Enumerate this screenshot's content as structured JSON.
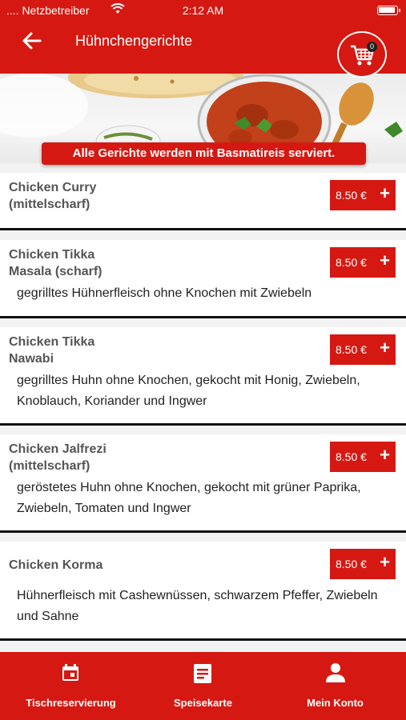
{
  "status_bar": {
    "carrier": "....  Netzbetreiber",
    "time": "2:12 AM"
  },
  "header": {
    "title": "Hühnchengerichte",
    "cart_count": "0"
  },
  "notice": "Alle Gerichte werden mit Basmatireis serviert.",
  "items": [
    {
      "name_line1": "Chicken Curry",
      "name_line2": "(mittelscharf)",
      "price": "8.50 €",
      "desc_line1": "",
      "desc_line2": ""
    },
    {
      "name_line1": "Chicken Tikka",
      "name_line2": "Masala (scharf)",
      "price": "8.50 €",
      "desc_line1": "gegrilltes Hühnerfleisch ohne Knochen mit Zwiebeln",
      "desc_line2": ""
    },
    {
      "name_line1": "Chicken Tikka",
      "name_line2": "Nawabi",
      "price": "8.50 €",
      "desc_line1": "gegrilltes Huhn ohne Knochen, gekocht mit Honig, Zwiebeln,",
      "desc_line2": "Knoblauch, Koriander und Ingwer"
    },
    {
      "name_line1": "Chicken Jalfrezi",
      "name_line2": "(mittelscharf)",
      "price": "8.50 €",
      "desc_line1": "geröstetes Huhn ohne Knochen, gekocht mit grüner Paprika,",
      "desc_line2": "Zwiebeln, Tomaten und Ingwer"
    },
    {
      "name_line1": "Chicken Korma",
      "name_line2": "",
      "price": "8.50 €",
      "desc_line1": "Hühnerfleisch mit Cashewnüssen, schwarzem Pfeffer, Zwiebeln",
      "desc_line2": "und Sahne"
    }
  ],
  "bottom_nav": [
    {
      "label": "Tischreservierung",
      "icon": "calendar-icon"
    },
    {
      "label": "Speisekarte",
      "icon": "menu-icon"
    },
    {
      "label": "Mein Konto",
      "icon": "person-icon"
    }
  ],
  "colors": {
    "accent": "#d51912"
  }
}
